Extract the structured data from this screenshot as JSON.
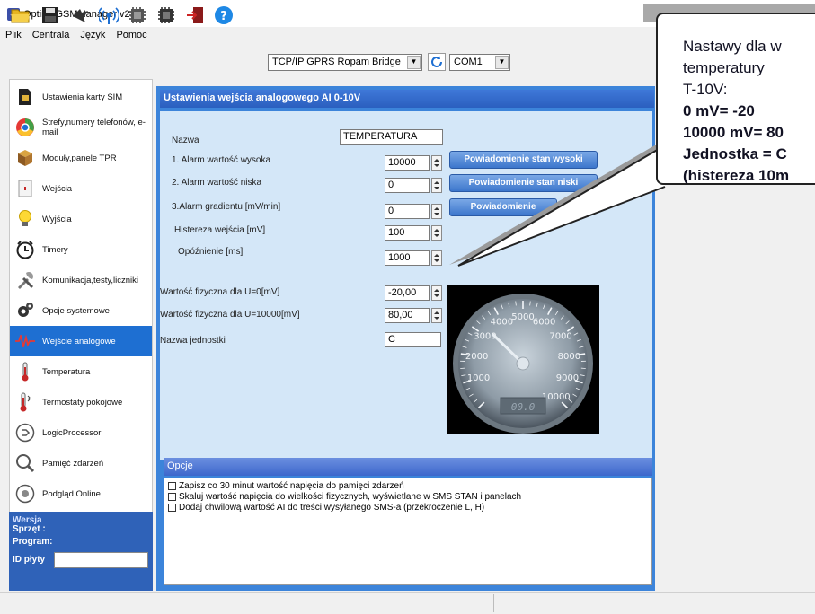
{
  "window": {
    "title": "OptimaGSMManager v2.2",
    "icon": "app-logo-icon"
  },
  "menu": {
    "items": [
      "Plik",
      "Centrala",
      "Język",
      "Pomoc"
    ]
  },
  "toolbar": {
    "icons": [
      "folder-open-icon",
      "save-icon",
      "arrow-icon",
      "antenna-icon",
      "chip-icon",
      "chip-dark-icon",
      "exit-door-icon",
      "help-icon"
    ],
    "connection_type": "TCP/IP GPRS Ropam Bridge",
    "port": "COM1"
  },
  "sidebar": {
    "items": [
      {
        "label": "Ustawienia karty SIM",
        "icon": "sim-card-icon"
      },
      {
        "label": "Strefy,numery telefonów, e-mail",
        "icon": "chrome-ball-icon"
      },
      {
        "label": "Moduły,panele TPR",
        "icon": "modules-icon"
      },
      {
        "label": "Wejścia",
        "icon": "inputs-icon"
      },
      {
        "label": "Wyjścia",
        "icon": "bulb-icon"
      },
      {
        "label": "Timery",
        "icon": "clock-icon"
      },
      {
        "label": "Komunikacja,testy,liczniki",
        "icon": "tools-icon"
      },
      {
        "label": "Opcje systemowe",
        "icon": "gears-icon"
      },
      {
        "label": "Wejście analogowe",
        "icon": "waveform-icon",
        "active": true
      },
      {
        "label": "Temperatura",
        "icon": "thermometer-icon"
      },
      {
        "label": "Termostaty pokojowe",
        "icon": "thermostat-icon"
      },
      {
        "label": "LogicProcessor",
        "icon": "logic-icon"
      },
      {
        "label": "Pamięć zdarzeń",
        "icon": "event-memory-icon"
      },
      {
        "label": "Podgląd Online",
        "icon": "online-preview-icon"
      }
    ],
    "version": {
      "legend": "Wersja",
      "hardware": "Sprzęt :",
      "program": "Program:",
      "board_id": "ID płyty"
    }
  },
  "main": {
    "header": "Ustawienia wejścia analogowego AI  0-10V",
    "fields": {
      "name_label": "Nazwa",
      "name_value": "TEMPERATURA",
      "alarm_high_label": "1. Alarm wartość wysoka",
      "alarm_high_value": "10000",
      "alarm_low_label": "2. Alarm wartość niska",
      "alarm_low_value": "0",
      "alarm_grad_label": "3.Alarm gradientu [mV/min]",
      "alarm_grad_value": "0",
      "hysteresis_label": "Histereza wejścia [mV]",
      "hysteresis_value": "100",
      "delay_label": "Opóźnienie [ms]",
      "delay_value": "1000",
      "phys_u0_label": "Wartość fizyczna dla U=0[mV]",
      "phys_u0_value": "-20,00",
      "phys_u10k_label": "Wartość fizyczna dla U=10000[mV]",
      "phys_u10k_value": "80,00",
      "unit_label": "Nazwa jednostki",
      "unit_value": "C"
    },
    "buttons": {
      "notify_high": "Powiadomienie stan wysoki",
      "notify_low": "Powiadomienie stan niski",
      "notify_grad": "Powiadomienie"
    },
    "gauge": {
      "ticks": [
        "1000",
        "2000",
        "3000",
        "4000",
        "5000",
        "6000",
        "7000",
        "8000",
        "9000",
        "10000"
      ],
      "readout": "00.0",
      "needle_value": 3300
    }
  },
  "options": {
    "title": "Opcje",
    "items": [
      "Zapisz co 30 minut wartość napięcia do pamięci zdarzeń",
      "Skaluj wartość napięcia do wielkości fizycznych, wyświetlane w SMS STAN  i panelach",
      "Dodaj chwilową wartość AI do treści wysyłanego SMS-a (przekroczenie L, H)"
    ]
  },
  "callout": {
    "lines": [
      "Nastawy dla w",
      "temperatury",
      "T-10V:",
      "0 mV= -20",
      "10000 mV= 80",
      "Jednostka = C",
      "(histereza 10m"
    ]
  }
}
